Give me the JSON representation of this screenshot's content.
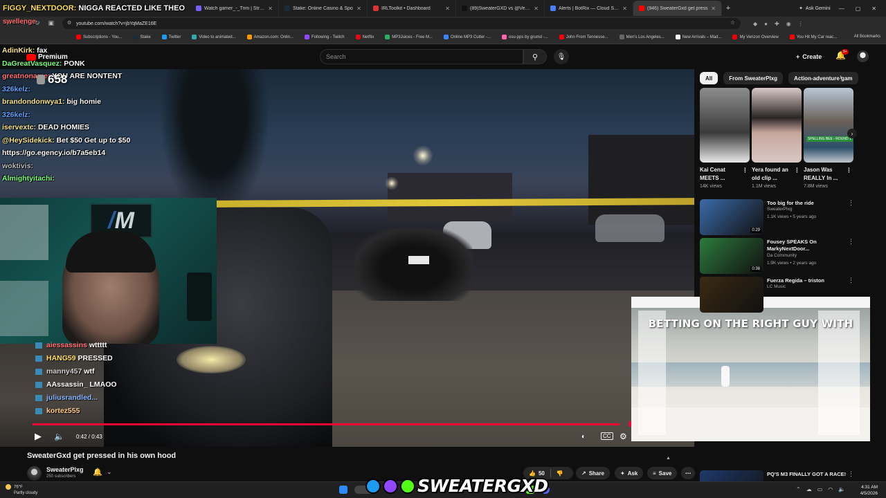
{
  "overlay": {
    "top_line_user": "FIGGY_NEXTDOOR:",
    "top_line_msg": "NIGGA REACTED LIKE THEO",
    "top_line2": "swellenge",
    "viewers": "658",
    "yt_logo": "Premium"
  },
  "chat": [
    {
      "user": "AdinKirk:",
      "msg": "fax",
      "cls": "u2"
    },
    {
      "user": "DaGreatVasquez:",
      "msg": "PONK",
      "cls": "u1"
    },
    {
      "user": "greatnoname:",
      "msg": "YOU ARE NONTENT",
      "cls": "u5"
    },
    {
      "user": "326kelz:",
      "msg": "",
      "cls": "u3"
    },
    {
      "user": "brandondonwya1:",
      "msg": "big homie",
      "cls": "u2"
    },
    {
      "user": "326kelz:",
      "msg": "",
      "cls": "u3"
    },
    {
      "user": "iservextc:",
      "msg": "DEAD HOMIES",
      "cls": "u2"
    },
    {
      "user": "@HeySidekick:",
      "msg": "Bet $50 Get up to $50",
      "cls": "u2"
    },
    {
      "user": "",
      "msg": "https://go.egency.io/b7a5eb14",
      "cls": "u2"
    },
    {
      "user": "woktivis:",
      "msg": "",
      "cls": "u7"
    },
    {
      "user": "Almightyitachi:",
      "msg": "",
      "cls": "u1"
    }
  ],
  "chat2": [
    {
      "user": "aiessassins",
      "msg": "wttttt",
      "cls": "c1"
    },
    {
      "user": "HANG59",
      "msg": "PRESSED",
      "cls": "c2"
    },
    {
      "user": "manny457",
      "msg": "wtf",
      "cls": "c3"
    },
    {
      "user": "AAssassin_",
      "msg": "LMAOO",
      "cls": "c4"
    },
    {
      "user": "juliusrandled...",
      "msg": "",
      "cls": "c5"
    },
    {
      "user": "kortez555",
      "msg": "",
      "cls": "c6"
    }
  ],
  "tabs": [
    {
      "label": "Watch gamer_-_Trim | Streamal",
      "color": "#7a5cff"
    },
    {
      "label": "Stake: Online Casino & Spo",
      "color": "#1a2c38"
    },
    {
      "label": "IRLToolkit • Dashboard",
      "color": "#d33"
    },
    {
      "label": "(89)SweaterGXD vs @Vexbolts",
      "color": "#111"
    },
    {
      "label": "Alerts | BotRix — Cloud Stream",
      "color": "#4a7dff"
    },
    {
      "label": "(946) SweaterGxd get press",
      "color": "#ff0000",
      "active": true
    }
  ],
  "browser": {
    "ask_gemini": "Ask Gemini",
    "url": "youtube.com/watch?v=jbYqMaZE16E",
    "all_bookmarks": "All Bookmarks"
  },
  "bookmarks": [
    {
      "label": "Subscriptions - You...",
      "color": "#ff0000"
    },
    {
      "label": "Stake",
      "color": "#1a2c38"
    },
    {
      "label": "Twitter",
      "color": "#1d9bf0"
    },
    {
      "label": "Video to animated...",
      "color": "#3aa"
    },
    {
      "label": "Amazon.com: Onlin...",
      "color": "#f90"
    },
    {
      "label": "Following - Twitch",
      "color": "#9146ff"
    },
    {
      "label": "Netflix",
      "color": "#e50914"
    },
    {
      "label": "MP3Juices - Free M...",
      "color": "#27ae60"
    },
    {
      "label": "Online MP3 Cutter -...",
      "color": "#3b82f6"
    },
    {
      "label": "osu-pps by grumd -...",
      "color": "#ff66aa"
    },
    {
      "label": "John From Tennesse...",
      "color": "#ff0000"
    },
    {
      "label": "Men's Los Angeles...",
      "color": "#666"
    },
    {
      "label": "New Arrivals – Mad...",
      "color": "#fff"
    },
    {
      "label": "My Verizon Overview",
      "color": "#e00"
    },
    {
      "label": "You Hit My Car reac...",
      "color": "#ff0000"
    }
  ],
  "youtube": {
    "search_placeholder": "Search",
    "create_label": "Create",
    "notif_count": "9+"
  },
  "player": {
    "time": "0:42 / 0:43",
    "progress_fraction": 0.98
  },
  "video": {
    "title": "SweaterGxd get pressed in his own hood",
    "channel": "SweaterPlxg",
    "subscribers": "250 subscribers",
    "likes": "50",
    "share": "Share",
    "ask": "Ask",
    "save": "Save"
  },
  "chips": [
    {
      "label": "All",
      "active": true
    },
    {
      "label": "From SweaterPlxg",
      "active": false
    },
    {
      "label": "Action-adventure gam",
      "active": false
    }
  ],
  "shorts": [
    {
      "title": "Kai Cenat MEETS ...",
      "views": "14K views"
    },
    {
      "title": "Yera found an old clip ...",
      "views": "1.1M views"
    },
    {
      "title": "Jason Was REALLY In ...",
      "views": "7.8M views",
      "caption": "SPELLING BEE - ROUND 1"
    }
  ],
  "recommendations": [
    {
      "title": "Too big for the ride",
      "channel": "SweaterPlxg",
      "meta": "1.1K views • 5 years ago",
      "duration": "0:29",
      "thumb": "#3b6aa8"
    },
    {
      "title": "Fousey SPEAKS On MarkyNextDoor...",
      "channel": "Da Community",
      "meta": "1.9K views • 2 years ago",
      "duration": "0:38",
      "thumb": "#2d7a3c"
    },
    {
      "title": "Fuerza Regida – triston",
      "channel": "LC Music",
      "meta": "",
      "duration": "",
      "thumb": "#3a2a12"
    },
    {
      "title": "PQ'S M3 FINALLY GOT A RACE!",
      "channel": "",
      "meta": "",
      "duration": "",
      "thumb": "#1e3a6a"
    }
  ],
  "ad": {
    "headline": "BETTING ON THE RIGHT GUY WITH"
  },
  "taskbar": {
    "temp": "76°F",
    "condition": "Partly cloudy",
    "time": "4:31 AM",
    "date": "4/5/2026"
  },
  "watermark": "SWEATERGXD"
}
